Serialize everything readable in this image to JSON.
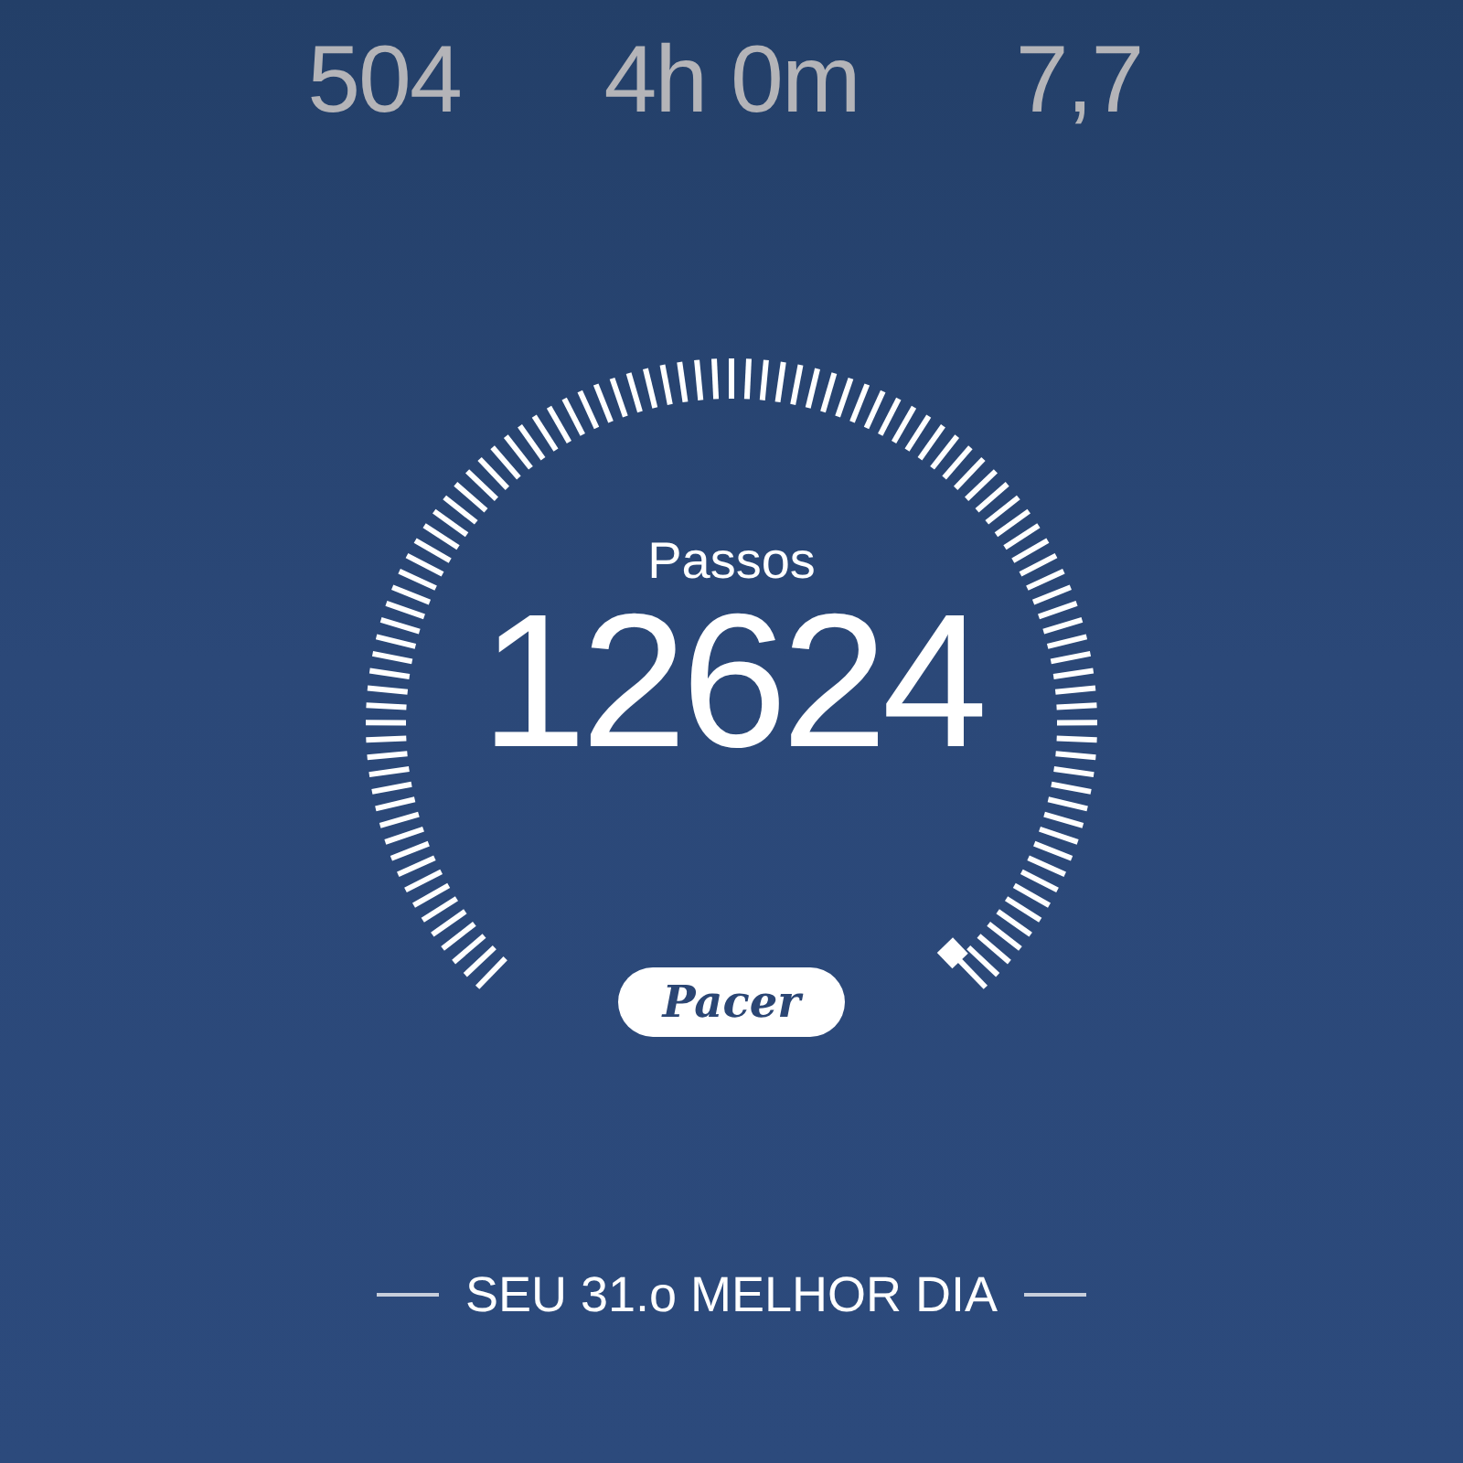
{
  "stats": [
    {
      "value": "504"
    },
    {
      "value": "4h 0m"
    },
    {
      "value": "7,7"
    }
  ],
  "gauge": {
    "label": "Passos",
    "value": "12624"
  },
  "logo": {
    "text": "Pacer"
  },
  "rank": {
    "text": "SEU 31.o MELHOR DIA"
  }
}
